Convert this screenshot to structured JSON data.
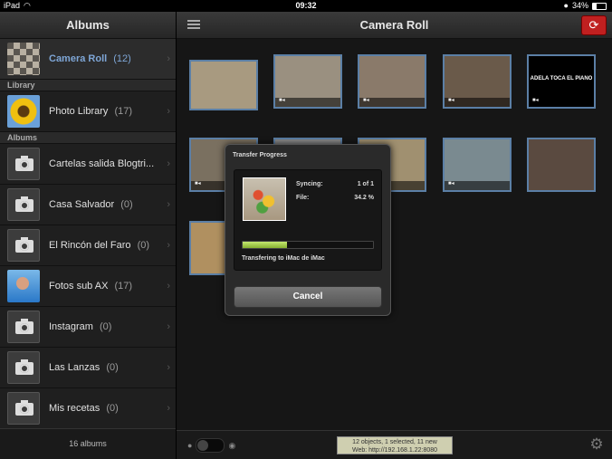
{
  "status_bar": {
    "device": "iPad",
    "time": "09:32",
    "battery": "34%"
  },
  "sidebar": {
    "title": "Albums",
    "top_item": {
      "label": "Camera Roll",
      "count": "(12)"
    },
    "section_library": "Library",
    "library_item": {
      "label": "Photo Library",
      "count": "(17)"
    },
    "section_albums": "Albums",
    "albums": [
      {
        "label": "Cartelas salida Blogtri...",
        "count": ""
      },
      {
        "label": "Casa Salvador",
        "count": "(0)"
      },
      {
        "label": "El Rincón del Faro",
        "count": "(0)"
      },
      {
        "label": "Fotos sub AX",
        "count": "(17)"
      },
      {
        "label": "Instagram",
        "count": "(0)"
      },
      {
        "label": "Las Lanzas",
        "count": "(0)"
      },
      {
        "label": "Mis recetas",
        "count": "(0)"
      }
    ],
    "footer": "16 albums"
  },
  "main": {
    "title": "Camera Roll",
    "photos": [
      {
        "type": "photo",
        "color": "#a89a80"
      },
      {
        "type": "video",
        "color": "#9a9080"
      },
      {
        "type": "video",
        "color": "#8a7a6a"
      },
      {
        "type": "video",
        "color": "#6a5a4a"
      },
      {
        "type": "video",
        "color": "#000000",
        "text": "ADELA TOCA EL PIANO"
      },
      {
        "type": "video",
        "color": "#7a7060"
      },
      {
        "type": "video",
        "color": "#8a8a8a"
      },
      {
        "type": "video",
        "color": "#a09070"
      },
      {
        "type": "video",
        "color": "#7a8a90"
      },
      {
        "type": "photo",
        "color": "#5a4a40"
      },
      {
        "type": "photo",
        "color": "#b09060"
      }
    ],
    "info_line1": "12 objects, 1 selected, 11 new",
    "info_line2": "Web: http://192.168.1.22:8080"
  },
  "modal": {
    "title": "Transfer Progress",
    "syncing_label": "Syncing:",
    "syncing_value": "1 of 1",
    "file_label": "File:",
    "file_value": "34.2 %",
    "progress": 0.342,
    "status": "Transfering to iMac de iMac",
    "cancel_label": "Cancel"
  }
}
